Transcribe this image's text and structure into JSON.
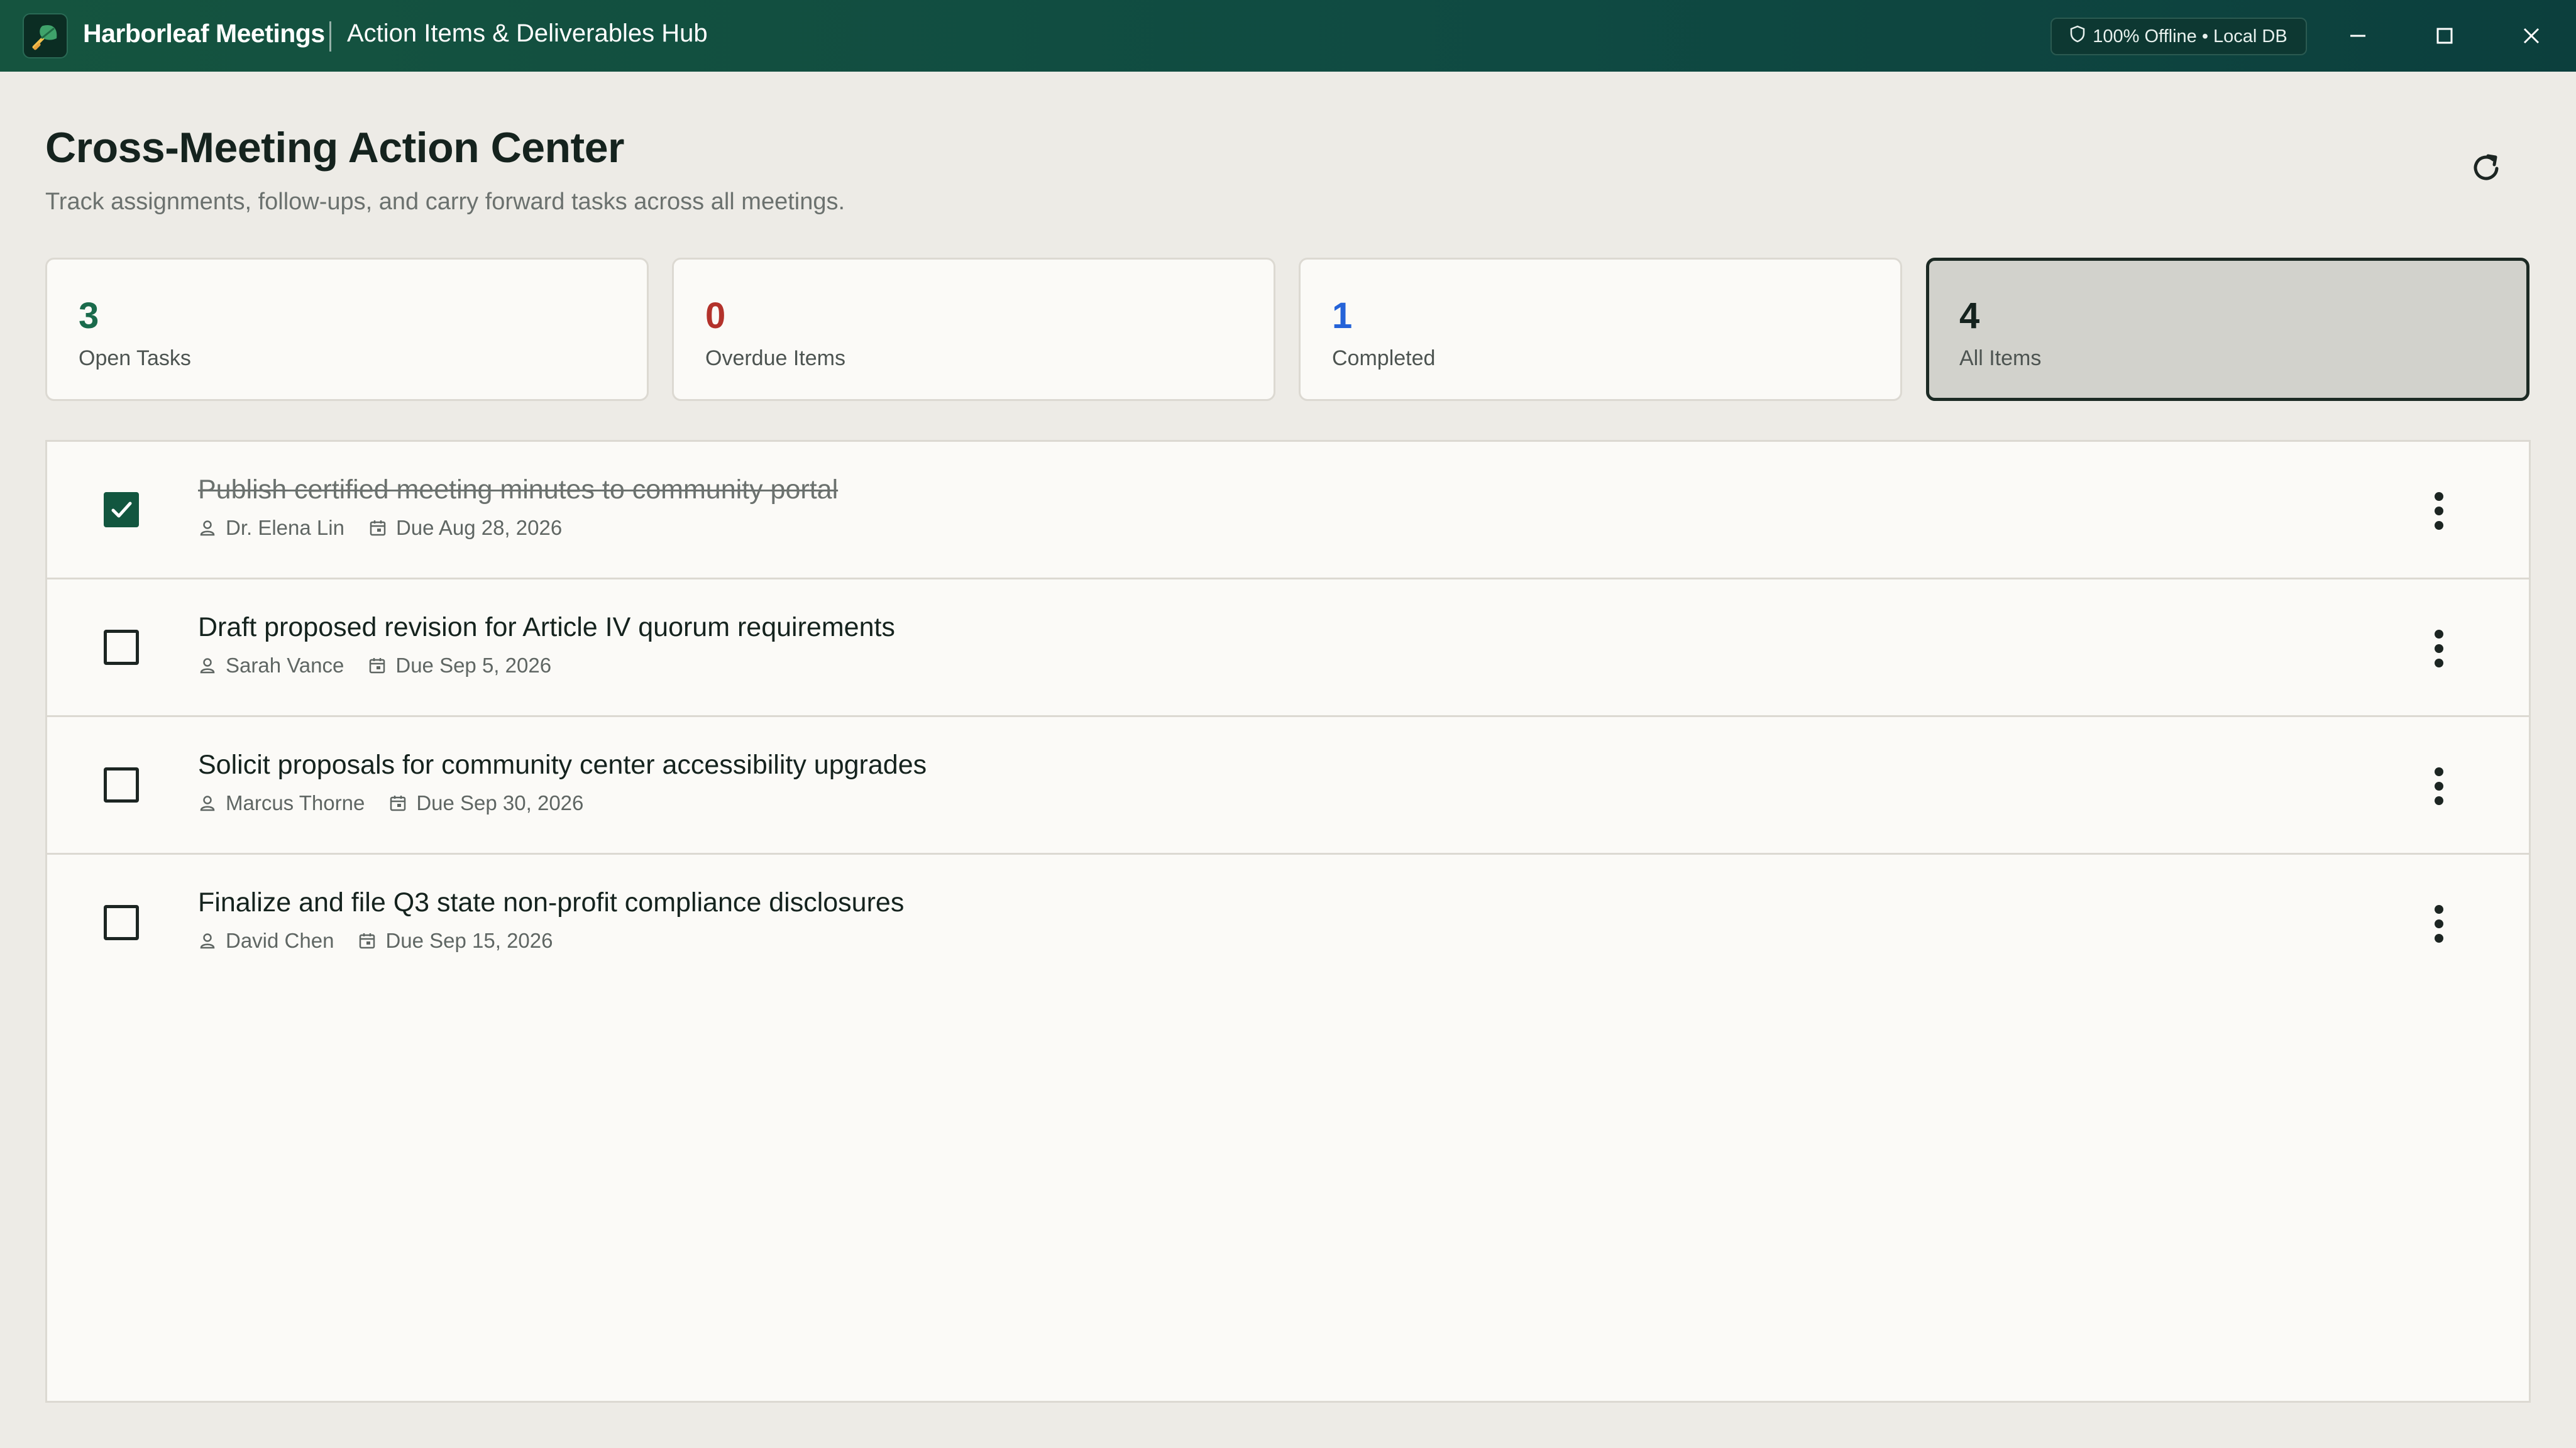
{
  "app": {
    "name": "Harborleaf Meetings",
    "section": "Action Items & Deliverables Hub",
    "status_badge": "100% Offline • Local DB"
  },
  "header": {
    "title": "Cross-Meeting Action Center",
    "subtitle": "Track assignments, follow-ups, and carry forward tasks across all meetings."
  },
  "stats": [
    {
      "value": "3",
      "label": "Open Tasks",
      "color": "#1a6b4c"
    },
    {
      "value": "0",
      "label": "Overdue Items",
      "color": "#b3322b"
    },
    {
      "value": "1",
      "label": "Completed",
      "color": "#2563d8"
    },
    {
      "value": "4",
      "label": "All Items",
      "color": "#15231e",
      "selected": true
    }
  ],
  "tasks": [
    {
      "title": "Publish certified meeting minutes to community portal",
      "assignee": "Dr. Elena Lin",
      "due": "Due Aug 28, 2026",
      "completed": true
    },
    {
      "title": "Draft proposed revision for Article IV quorum requirements",
      "assignee": "Sarah Vance",
      "due": "Due Sep 5, 2026",
      "completed": false
    },
    {
      "title": "Solicit proposals for community center accessibility upgrades",
      "assignee": "Marcus Thorne",
      "due": "Due Sep 30, 2026",
      "completed": false
    },
    {
      "title": "Finalize and file Q3 state non-profit compliance disclosures",
      "assignee": "David Chen",
      "due": "Due Sep 15, 2026",
      "completed": false
    }
  ],
  "colors": {
    "accent": "#12563f",
    "titlebar": "#15543f"
  }
}
